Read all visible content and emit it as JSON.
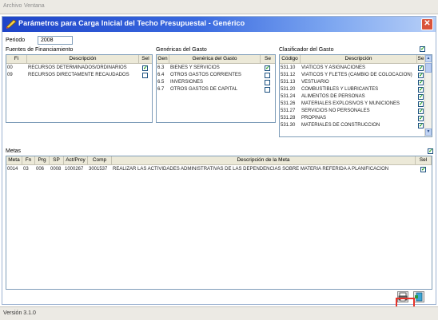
{
  "menu": {
    "items": [
      "Archivo",
      "Ventana"
    ]
  },
  "dialog": {
    "title": "Parámetros para Carga Inicial del Techo Presupuestal - Genérico",
    "close_label": "✕"
  },
  "periodo": {
    "label": "Periodo",
    "value": "2008"
  },
  "fuentes": {
    "label": "Fuentes de Financiamiento",
    "headers": [
      "Fi",
      "Descripción",
      "Sel"
    ],
    "rows": [
      {
        "code": "00",
        "desc": "RECURSOS DETERMINADOS/ORDINARIOS",
        "sel": true
      },
      {
        "code": "09",
        "desc": "RECURSOS DIRECTAMENTE RECAUDADOS",
        "sel": false
      }
    ]
  },
  "genericas": {
    "label": "Genéricas del Gasto",
    "headers": [
      "Gen",
      "Genérica del Gasto",
      "Se"
    ],
    "rows": [
      {
        "code": "6.3",
        "desc": "BIENES Y SERVICIOS",
        "sel": true
      },
      {
        "code": "6.4",
        "desc": "OTROS GASTOS CORRIENTES",
        "sel": false
      },
      {
        "code": "6.5",
        "desc": "INVERSIONES",
        "sel": false
      },
      {
        "code": "6.7",
        "desc": "OTROS GASTOS DE CAPITAL",
        "sel": false
      }
    ]
  },
  "clasificador": {
    "label": "Clasificador del Gasto",
    "headers": [
      "Código",
      "Descripción",
      "Se"
    ],
    "rows": [
      {
        "code": "531.10",
        "desc": "VIATICOS Y ASIGNACIONES",
        "sel": true
      },
      {
        "code": "531.12",
        "desc": "VIATICOS Y FLETES (CAMBIO DE COLOCACION)",
        "sel": true
      },
      {
        "code": "531.13",
        "desc": "VESTUARIO",
        "sel": true
      },
      {
        "code": "531.20",
        "desc": "COMBUSTIBLES Y LUBRICANTES",
        "sel": true
      },
      {
        "code": "531.24",
        "desc": "ALIMENTOS DE PERSONAS",
        "sel": true
      },
      {
        "code": "531.26",
        "desc": "MATERIALES EXPLOSIVOS Y MUNICIONES",
        "sel": true
      },
      {
        "code": "531.27",
        "desc": "SERVICIOS NO PERSONALES",
        "sel": true
      },
      {
        "code": "531.28",
        "desc": "PROPINAS",
        "sel": true
      },
      {
        "code": "531.30",
        "desc": "MATERIALES DE CONSTRUCCION",
        "sel": true
      }
    ]
  },
  "metas": {
    "label": "Metas",
    "headers": [
      "Meta",
      "Fn",
      "Prg",
      "SP",
      "Act/Proy",
      "Comp",
      "Descripción de la Meta",
      "Sel"
    ],
    "rows": [
      {
        "meta": "0014",
        "fn": "03",
        "prg": "006",
        "sp": "0008",
        "act": "1000267",
        "comp": "3001537",
        "desc": "REALIZAR LAS ACTIVIDADES ADMINISTRATIVAS DE LAS DEPENDENCIAS SOBRE MATERIA REFERIDA A PLANIFICACION",
        "sel": true
      }
    ]
  },
  "status": {
    "version": "Versión 3.1.0"
  }
}
